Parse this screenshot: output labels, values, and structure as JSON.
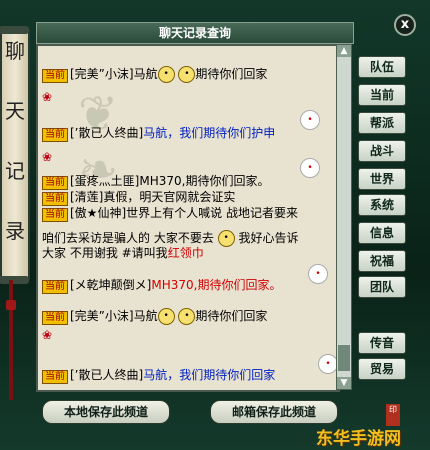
{
  "window": {
    "title": "聊天记录查询",
    "scroll_title": [
      "聊",
      "天",
      "记",
      "录"
    ],
    "close": "x"
  },
  "chat": {
    "lines": [
      {
        "tag": "当前",
        "name": "[完美”小沫]马航",
        "emoji": [
          "🙁",
          "🙁"
        ],
        "text": "期待你们回家",
        "color": "black"
      },
      {
        "tag": "当前",
        "name": "[’散已人终曲]",
        "text": "马航，我们期待你们护申",
        "color": "blue"
      },
      {
        "tag": "当前",
        "name": "[蛋疼灬土匪]MH370,",
        "text": "期待你们回家。",
        "color": "black"
      },
      {
        "tag": "当前",
        "name": "[清莲]真假，",
        "text": "明天官网就会证实",
        "color": "black"
      },
      {
        "tag": "当前",
        "name": "[傲★仙神]",
        "text": "世界上有个人喊说 战地记者要来",
        "color": "black"
      },
      {
        "tag": "",
        "name": "",
        "text": "咱们去采访是骗人的 大家不要去",
        "color": "black"
      },
      {
        "tag": "",
        "name": "",
        "text": "我好心告诉",
        "color": "black"
      },
      {
        "tag": "",
        "name": "",
        "text": "大家  不用谢我 #请叫我",
        "color": "black"
      },
      {
        "tag": "",
        "name": "",
        "text": "红领巾",
        "color": "red"
      },
      {
        "tag": "当前",
        "name": "[メ乾坤颠倒メ]",
        "text": "MH370,期待你们回家。",
        "color": "red"
      },
      {
        "tag": "当前",
        "name": "[完美”小沫]马航",
        "emoji": [
          "🙁",
          "🙁"
        ],
        "text": "期待你们回家",
        "color": "black"
      },
      {
        "tag": "当前",
        "name": "[’散已人终曲]",
        "text": "马航，我们期待你们回家",
        "color": "blue"
      }
    ]
  },
  "side_buttons": [
    "队伍",
    "当前",
    "帮派",
    "战斗",
    "世界",
    "系统",
    "信息",
    "祝福",
    "团队",
    "传音",
    "贸易"
  ],
  "bottom": {
    "save_local": "本地保存此频道",
    "save_mail": "邮箱保存此频道"
  },
  "watermark": "东华手游网",
  "seal": "印"
}
